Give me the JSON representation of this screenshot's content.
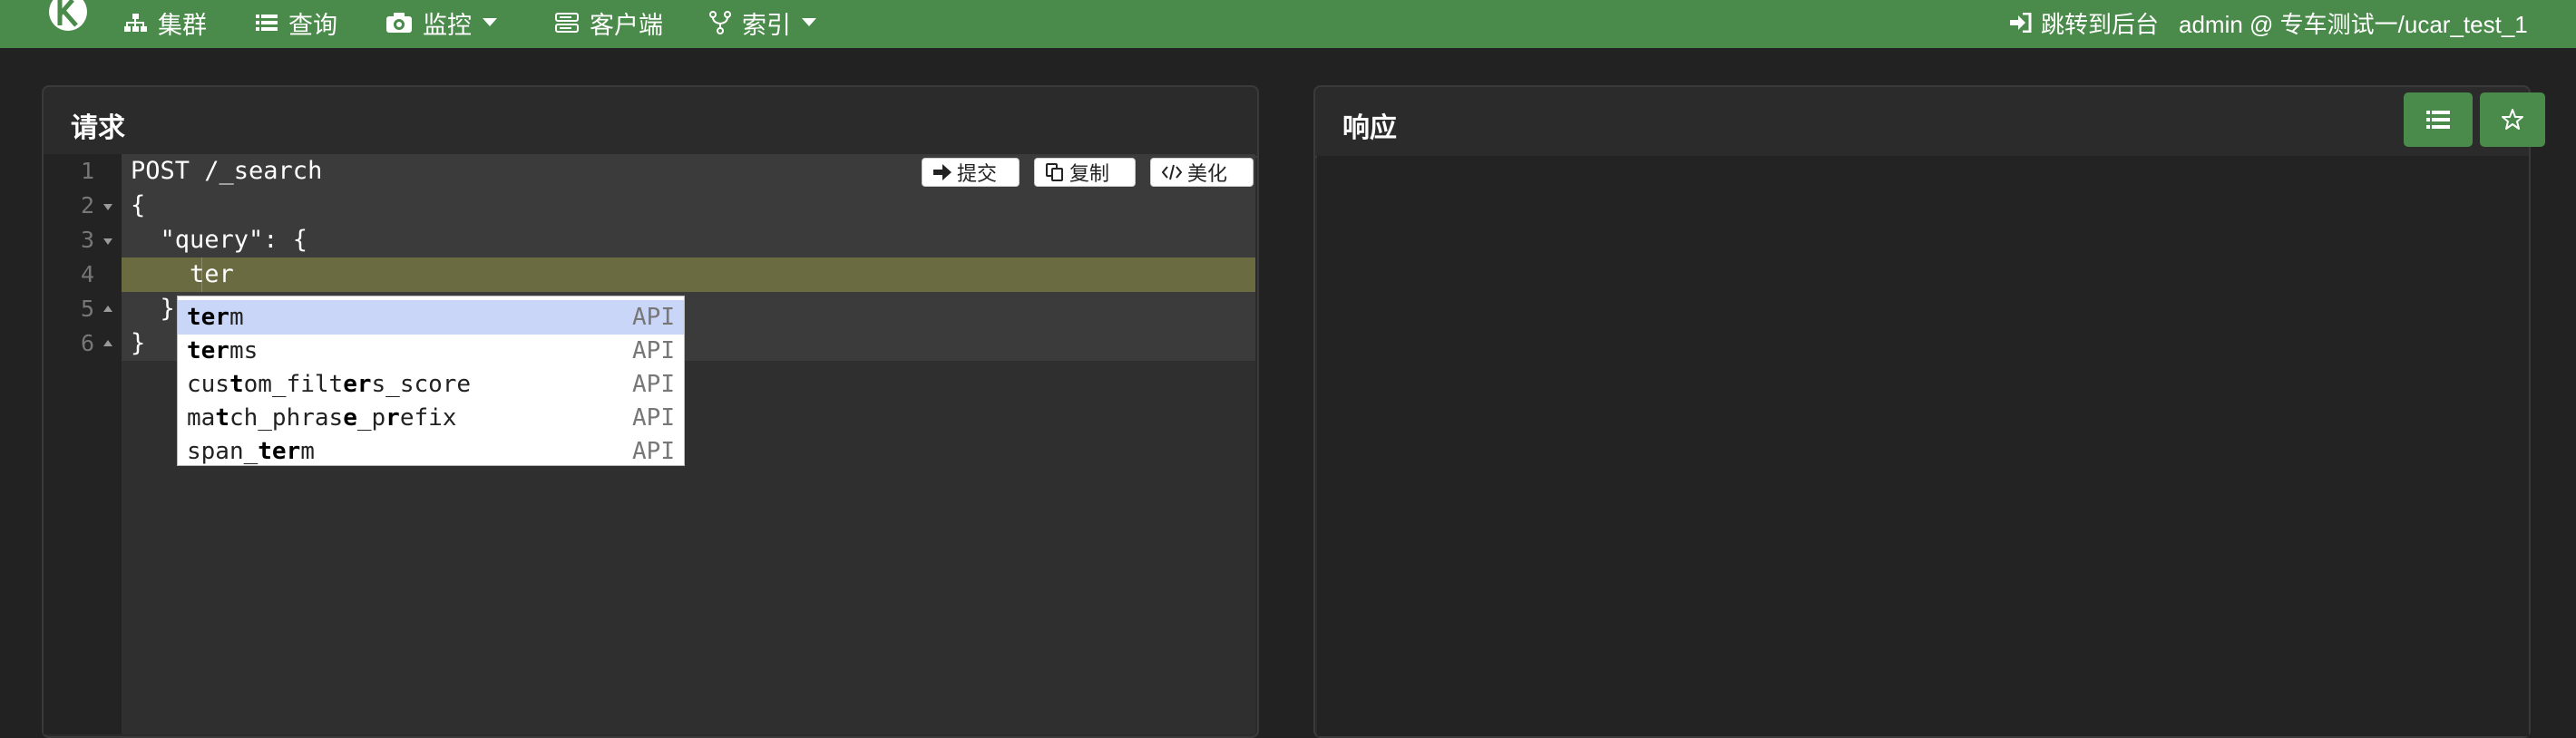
{
  "navbar": {
    "brand_icon": "kibana-logo-icon",
    "items": [
      {
        "label": "集群",
        "icon": "sitemap-icon"
      },
      {
        "label": "查询",
        "icon": "list-icon"
      },
      {
        "label": "监控",
        "icon": "camera-icon",
        "dropdown": true
      },
      {
        "label": "客户端",
        "icon": "server-icon"
      },
      {
        "label": "索引",
        "icon": "git-fork-icon",
        "dropdown": true
      }
    ],
    "backend_link": "跳转到后台",
    "user_info": "admin @ 专车测试一/ucar_test_1",
    "bg_color": "#4a8a4a"
  },
  "request_panel": {
    "title": "请求",
    "buttons": {
      "submit": "提交",
      "copy": "复制",
      "beautify": "美化"
    },
    "line_numbers": [
      "1",
      "2",
      "3",
      "4",
      "5",
      "6"
    ],
    "code_lines": [
      "POST /_search",
      "{",
      "  \"query\": {",
      "    ter",
      "  }",
      "}"
    ]
  },
  "autocomplete": {
    "items": [
      {
        "parts": [
          [
            "ter",
            true
          ],
          [
            "m",
            false
          ]
        ],
        "meta": "API",
        "selected": true
      },
      {
        "parts": [
          [
            "ter",
            true
          ],
          [
            "ms",
            false
          ]
        ],
        "meta": "API",
        "selected": false
      },
      {
        "parts": [
          [
            "cus",
            false
          ],
          [
            "t",
            true
          ],
          [
            "om_filt",
            false
          ],
          [
            "er",
            true
          ],
          [
            "s_score",
            false
          ]
        ],
        "meta": "API",
        "selected": false
      },
      {
        "parts": [
          [
            "ma",
            false
          ],
          [
            "t",
            true
          ],
          [
            "ch_phras",
            false
          ],
          [
            "e",
            true
          ],
          [
            "_p",
            false
          ],
          [
            "r",
            true
          ],
          [
            "efix",
            false
          ]
        ],
        "meta": "API",
        "selected": false
      },
      {
        "parts": [
          [
            "span_",
            false
          ],
          [
            "ter",
            true
          ],
          [
            "m",
            false
          ]
        ],
        "meta": "API",
        "selected": false
      }
    ]
  },
  "response_panel": {
    "title": "响应",
    "buttons": [
      {
        "icon": "list-icon"
      },
      {
        "icon": "star-icon"
      }
    ]
  }
}
